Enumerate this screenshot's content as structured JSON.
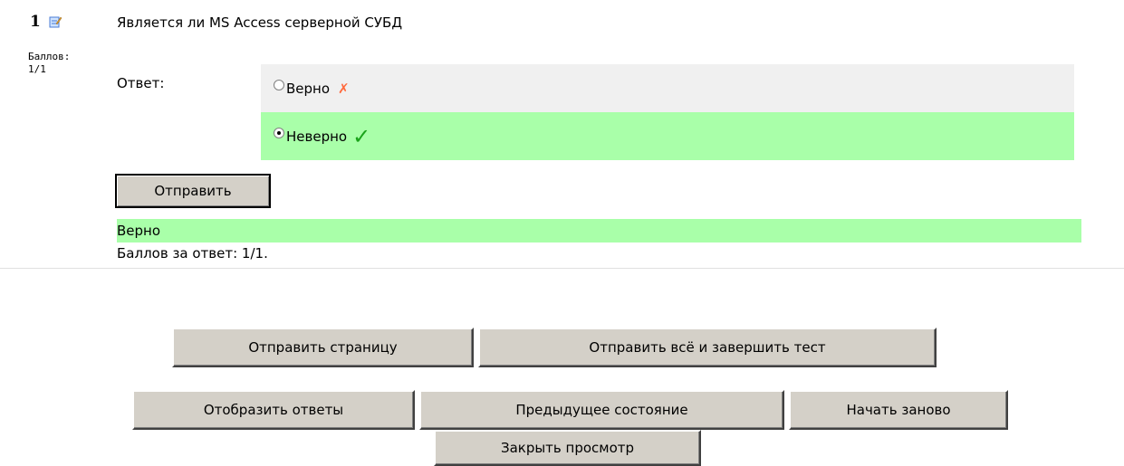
{
  "question": {
    "number": "1",
    "grade_label": "Баллов:",
    "grade_value": "1/1",
    "text": "Является ли MS Access серверной СУБД",
    "answer_label": "Ответ:",
    "options": [
      {
        "label": "Верно",
        "selected": false,
        "mark": "✗"
      },
      {
        "label": "Неверно",
        "selected": true,
        "mark": "✓"
      }
    ],
    "submit_label": "Отправить"
  },
  "feedback": {
    "result": "Верно",
    "score": "Баллов за ответ: 1/1."
  },
  "nav_buttons": {
    "submit_page": "Отправить страницу",
    "submit_all": "Отправить всё и завершить тест",
    "show_answers": "Отобразить ответы",
    "previous_state": "Предыдущее состояние",
    "start_again": "Начать заново",
    "close_preview": "Закрыть просмотр"
  },
  "colors": {
    "correct_bg": "#a9ffa9",
    "option_bg": "#f0f0f0",
    "wrong_mark": "#ff6a3d",
    "right_mark": "#1aa31a",
    "button_face": "#d4d0c8"
  },
  "icons": {
    "edit": "edit-icon",
    "wrong": "cross-mark-icon",
    "right": "check-mark-icon"
  }
}
